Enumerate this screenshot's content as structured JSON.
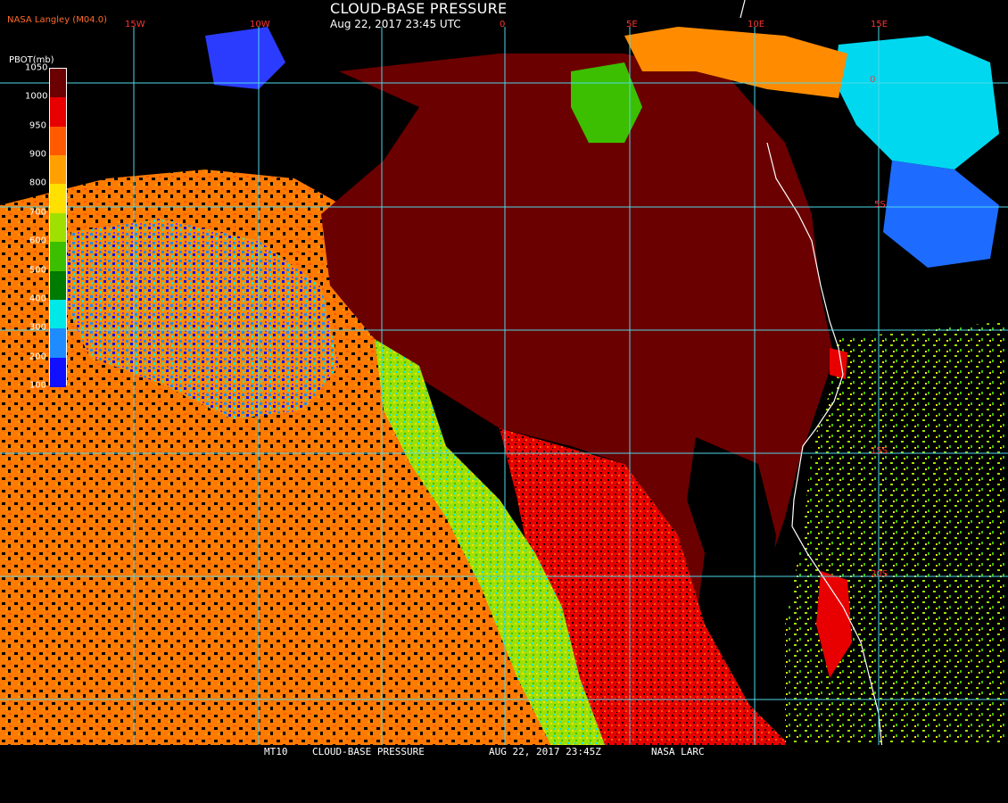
{
  "header": {
    "title": "CLOUD-BASE PRESSURE",
    "subtitle": "Aug 22, 2017 23:45 UTC",
    "producer": "NASA Langley (M04.0)"
  },
  "footer": {
    "satellite": "MT10",
    "product": "CLOUD-BASE PRESSURE",
    "datetime": "AUG 22, 2017 23:45Z",
    "agency": "NASA LARC"
  },
  "legend": {
    "unit_label": "PBOT(mb)",
    "levels": [
      {
        "label": "1050",
        "color": "#6b0000"
      },
      {
        "label": "1000",
        "color": "#e80000"
      },
      {
        "label": "950",
        "color": "#ff5a00"
      },
      {
        "label": "900",
        "color": "#ffa000"
      },
      {
        "label": "800",
        "color": "#ffe000"
      },
      {
        "label": "700",
        "color": "#a0e000"
      },
      {
        "label": "600",
        "color": "#3cbf00"
      },
      {
        "label": "500",
        "color": "#007a00"
      },
      {
        "label": "400",
        "color": "#00e8e8"
      },
      {
        "label": "300",
        "color": "#1e8cff"
      },
      {
        "label": "200",
        "color": "#1010ff"
      },
      {
        "label": "100",
        "color": "#8c28ff"
      }
    ]
  },
  "grid": {
    "line_color": "#4fd8e8",
    "longitude_labels": [
      "15W",
      "10W",
      "0",
      "5E",
      "10E",
      "15E"
    ],
    "latitude_labels": [
      "0",
      "5S",
      "15S",
      "20S"
    ],
    "label_color": "#ff3333"
  },
  "colors": {
    "ocean_stratus": "#6b0000",
    "coastline": "#ffffff",
    "background": "#000000"
  }
}
